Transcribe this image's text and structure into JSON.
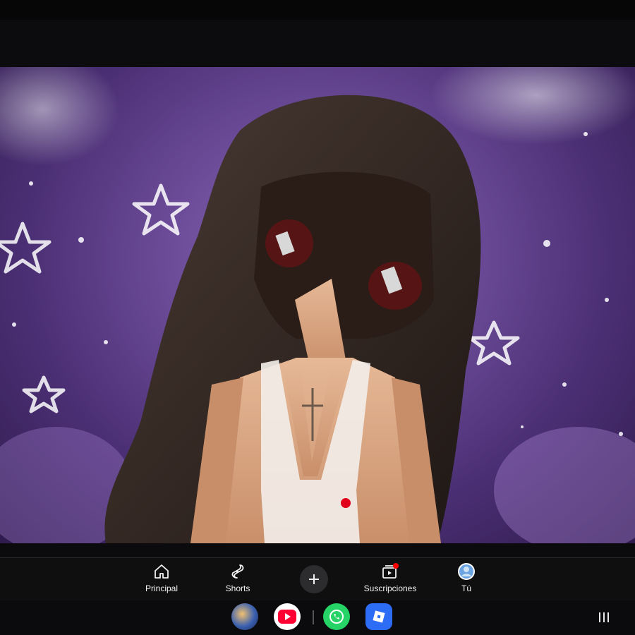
{
  "nav": {
    "items": [
      {
        "key": "home",
        "label": "Principal",
        "icon": "home-icon"
      },
      {
        "key": "shorts",
        "label": "Shorts",
        "icon": "shorts-icon"
      },
      {
        "key": "create",
        "label": "",
        "icon": "plus-icon"
      },
      {
        "key": "subscriptions",
        "label": "Suscripciones",
        "icon": "subscriptions-icon"
      },
      {
        "key": "you",
        "label": "Tú",
        "icon": "avatar-icon"
      }
    ]
  },
  "dock": {
    "apps": [
      {
        "name": "game-app-icon"
      },
      {
        "name": "youtube-app-icon"
      },
      {
        "name": "whatsapp-app-icon"
      },
      {
        "name": "roblox-app-icon"
      }
    ]
  },
  "colors": {
    "nav_bg": "#0f0f10",
    "video_purple": "#6a4a96",
    "youtube_red": "#ff0033",
    "whatsapp_green": "#25d366",
    "roblox_blue": "#2d6cf5",
    "notification_dot": "#ff0000"
  }
}
